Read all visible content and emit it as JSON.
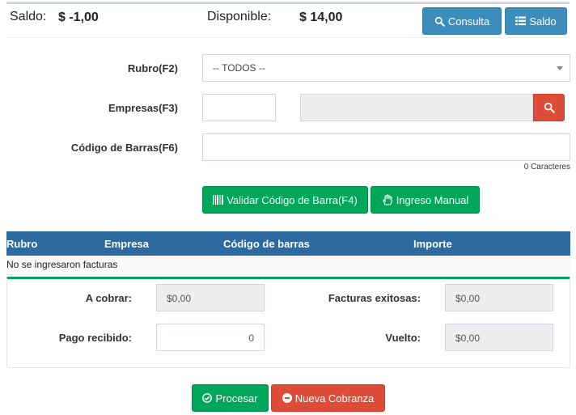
{
  "header": {
    "saldo_label": "Saldo:",
    "saldo_value": "$ -1,00",
    "disponible_label": "Disponible:",
    "disponible_value": "$ 14,00",
    "consulta_label": "Consulta",
    "saldo_button_label": "Saldo"
  },
  "form": {
    "rubro_label": "Rubro(F2)",
    "rubro_selected": "-- TODOS --",
    "empresas_label": "Empresas(F3)",
    "empresa_code_value": "",
    "empresa_name_value": "",
    "codigo_label": "Código de Barras(F6)",
    "codigo_value": "",
    "char_count": "0 Caracteres",
    "validar_label": "Validar Código de Barra(F4)",
    "manual_label": "Ingreso Manual"
  },
  "table": {
    "columns": [
      "Rubro",
      "Empresa",
      "Código de barras",
      "Importe"
    ],
    "empty_message": "No se ingresaron facturas"
  },
  "summary": {
    "cobrar_label": "A cobrar:",
    "cobrar_value": "$0,00",
    "pago_label": "Pago recibido:",
    "pago_value": "0",
    "facturas_label": "Facturas exitosas:",
    "facturas_value": "$0,00",
    "vuelto_label": "Vuelto:",
    "vuelto_value": "$0,00"
  },
  "actions": {
    "procesar_label": "Procesar",
    "nueva_label": "Nueva Cobranza"
  },
  "colors": {
    "info": "#3c8dbc",
    "success": "#00a65a",
    "danger": "#dd4b39",
    "table_header": "#2c6aa0"
  },
  "icons": {
    "consulta": "search-icon",
    "saldo": "list-icon",
    "empresa_search": "search-icon",
    "validar": "barcode-icon",
    "manual": "hand-icon",
    "procesar": "check-circle-icon",
    "nueva": "minus-circle-icon"
  }
}
